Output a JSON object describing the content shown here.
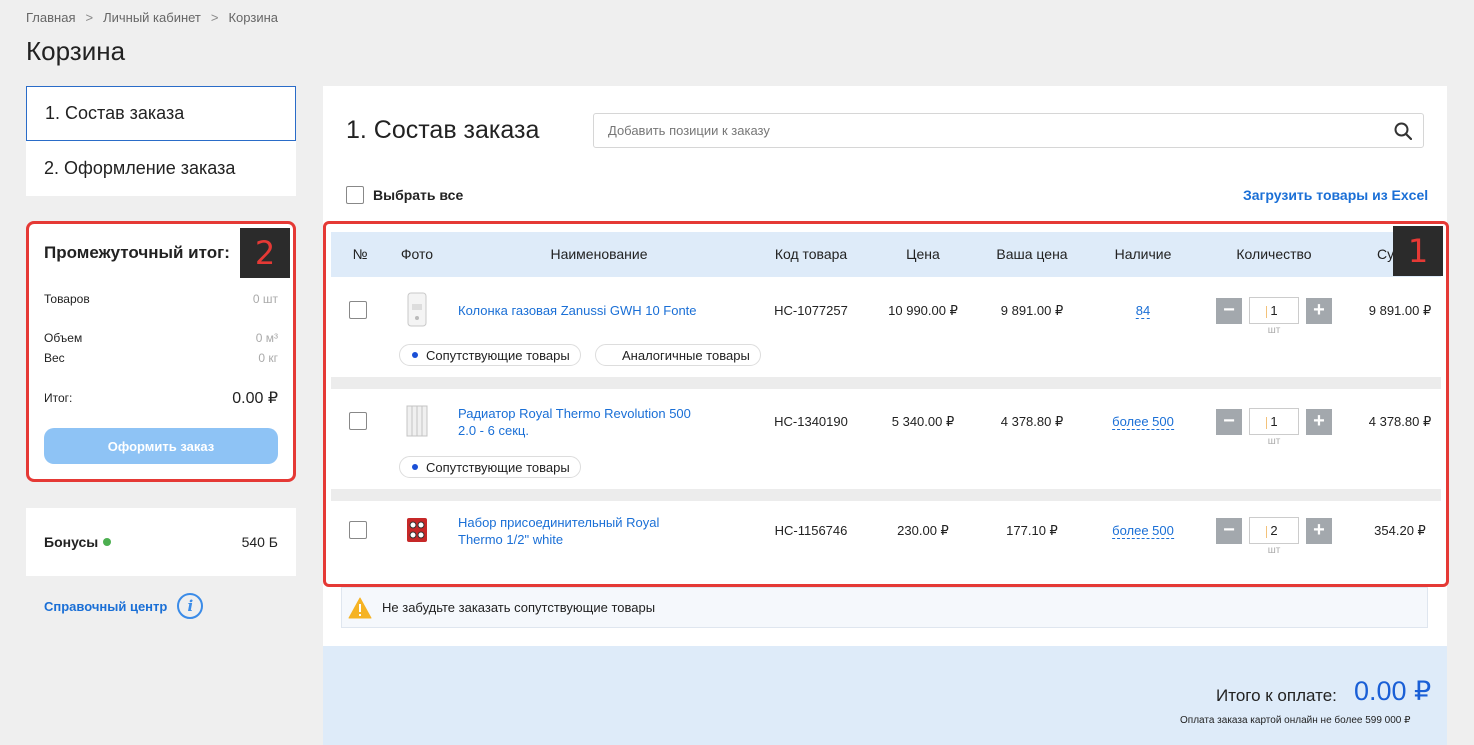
{
  "breadcrumb": [
    "Главная",
    "Личный кабинет",
    "Корзина"
  ],
  "breadcrumb_sep": ">",
  "page_title": "Корзина",
  "steps": [
    "1. Состав заказа",
    "2. Оформление заказа"
  ],
  "summary": {
    "title": "Промежуточный итог:",
    "marker": "2",
    "items_label": "Товаров",
    "items_value": "0 шт",
    "volume_label": "Объем",
    "volume_value": "0 м³",
    "weight_label": "Вес",
    "weight_value": "0 кг",
    "total_label": "Итог:",
    "total_value": "0.00 ₽",
    "order_button": "Оформить заказ"
  },
  "bonus": {
    "label": "Бонусы",
    "value": "540 Б",
    "icon": "bonus-dot-icon"
  },
  "help": {
    "label": "Справочный центр",
    "icon_text": "i"
  },
  "main": {
    "title": "1. Состав заказа",
    "search_placeholder": "Добавить позиции к заказу",
    "select_all": "Выбрать все",
    "excel_link": "Загрузить товары из Excel",
    "marker": "1"
  },
  "columns": [
    "№",
    "Фото",
    "Наименование",
    "Код товара",
    "Цена",
    "Ваша цена",
    "Наличие",
    "Количество",
    "Сумма"
  ],
  "rows": [
    {
      "name": "Колонка газовая Zanussi GWH 10 Fonte",
      "code": "НС-1077257",
      "price": "10 990.00 ₽",
      "your_price": "9 891.00 ₽",
      "availability": "84",
      "qty": "1",
      "unit": "шт",
      "sum": "9 891.00 ₽",
      "tags": [
        "Сопутствующие товары",
        "Аналогичные товары"
      ]
    },
    {
      "name": "Радиатор Royal Thermo Revolution 500 2.0 - 6 секц.",
      "code": "НС-1340190",
      "price": "5 340.00 ₽",
      "your_price": "4 378.80 ₽",
      "availability": "более 500",
      "qty": "1",
      "unit": "шт",
      "sum": "4 378.80 ₽",
      "tags": [
        "Сопутствующие товары"
      ]
    },
    {
      "name": "Набор присоединительный Royal Thermo 1/2\" white",
      "code": "НС-1156746",
      "price": "230.00 ₽",
      "your_price": "177.10 ₽",
      "availability": "более 500",
      "qty": "2",
      "unit": "шт",
      "sum": "354.20 ₽",
      "tags": []
    }
  ],
  "notice": "Не забудьте заказать сопутствующие товары",
  "payment": {
    "label": "Итого к оплате:",
    "amount": "0.00 ₽",
    "note": "Оплата заказа картой онлайн не более 599 000 ₽"
  },
  "colors": {
    "accent": "#1a6fd6",
    "highlight": "#e53935",
    "header_bg": "#deebf9"
  }
}
